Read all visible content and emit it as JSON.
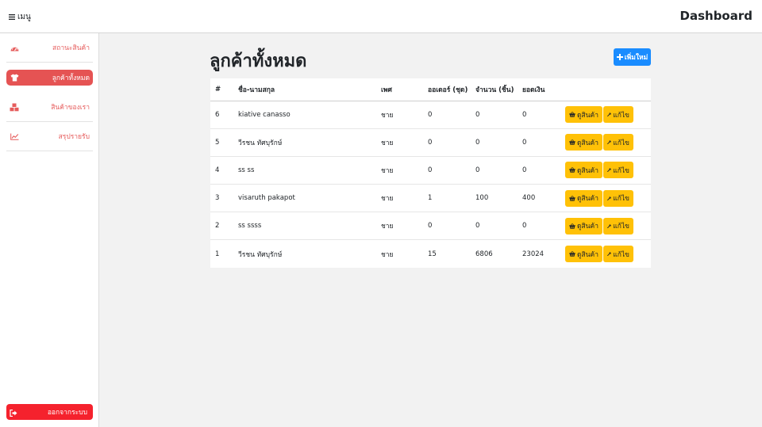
{
  "header": {
    "menu_label": "เมนู",
    "brand": "Dashboard"
  },
  "sidebar": {
    "items": [
      {
        "label": "สถานะสินค้า",
        "icon": "dashboard-gauge-icon",
        "active": false
      },
      {
        "label": "ลูกค้าทั้งหมด",
        "icon": "shirt-icon",
        "active": true
      },
      {
        "label": "สินค้าของเรา",
        "icon": "cubes-icon",
        "active": false
      },
      {
        "label": "สรุปรายรับ",
        "icon": "line-chart-icon",
        "active": false
      }
    ],
    "logout_label": "ออกจากระบบ"
  },
  "main": {
    "title": "ลูกค้าทั้งหมด",
    "add_button_label": "เพิ่มใหม่",
    "table": {
      "columns": [
        "#",
        "ชื่อ-นามสกุล",
        "เพศ",
        "ออเดอร์ (ชุด)",
        "จำนวน (ชิ้น)",
        "ยอดเงิน",
        ""
      ],
      "rows": [
        {
          "id": "6",
          "name": "kiative canasso",
          "gender": "ชาย",
          "orders": "0",
          "qty": "0",
          "amount": "0"
        },
        {
          "id": "5",
          "name": "วีรชน ทัศบุรักษ์",
          "gender": "ชาย",
          "orders": "0",
          "qty": "0",
          "amount": "0"
        },
        {
          "id": "4",
          "name": "ss ss",
          "gender": "ชาย",
          "orders": "0",
          "qty": "0",
          "amount": "0"
        },
        {
          "id": "3",
          "name": "visaruth pakapot",
          "gender": "ชาย",
          "orders": "1",
          "qty": "100",
          "amount": "400"
        },
        {
          "id": "2",
          "name": "ss ssss",
          "gender": "ชาย",
          "orders": "0",
          "qty": "0",
          "amount": "0"
        },
        {
          "id": "1",
          "name": "วีรชน ทัศบุรักษ์",
          "gender": "ชาย",
          "orders": "15",
          "qty": "6806",
          "amount": "23024"
        }
      ],
      "view_label": "ดูสินค้า",
      "edit_label": "แก้ไข"
    }
  },
  "colors": {
    "accent_red": "#e55353",
    "logout_red": "#f5222d",
    "primary_blue": "#1a8cff",
    "warning_yellow": "#ffc107"
  }
}
